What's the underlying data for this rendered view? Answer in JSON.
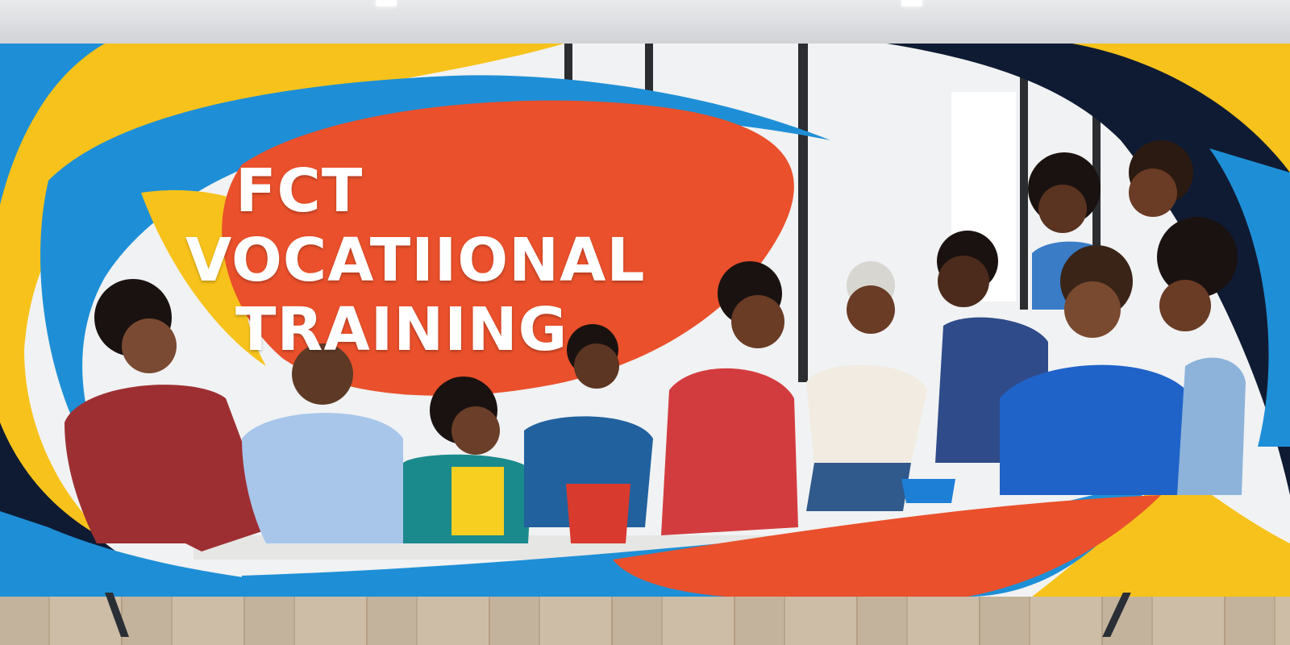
{
  "banner": {
    "headline": {
      "line1": "FCT",
      "line2": "VOCATIIONAL",
      "line3": "TRAINING"
    }
  },
  "colors": {
    "blue": "#1e8fd6",
    "yellow": "#f7c21b",
    "orange": "#e9502b",
    "navy": "#0f1b33",
    "white": "#ffffff"
  }
}
